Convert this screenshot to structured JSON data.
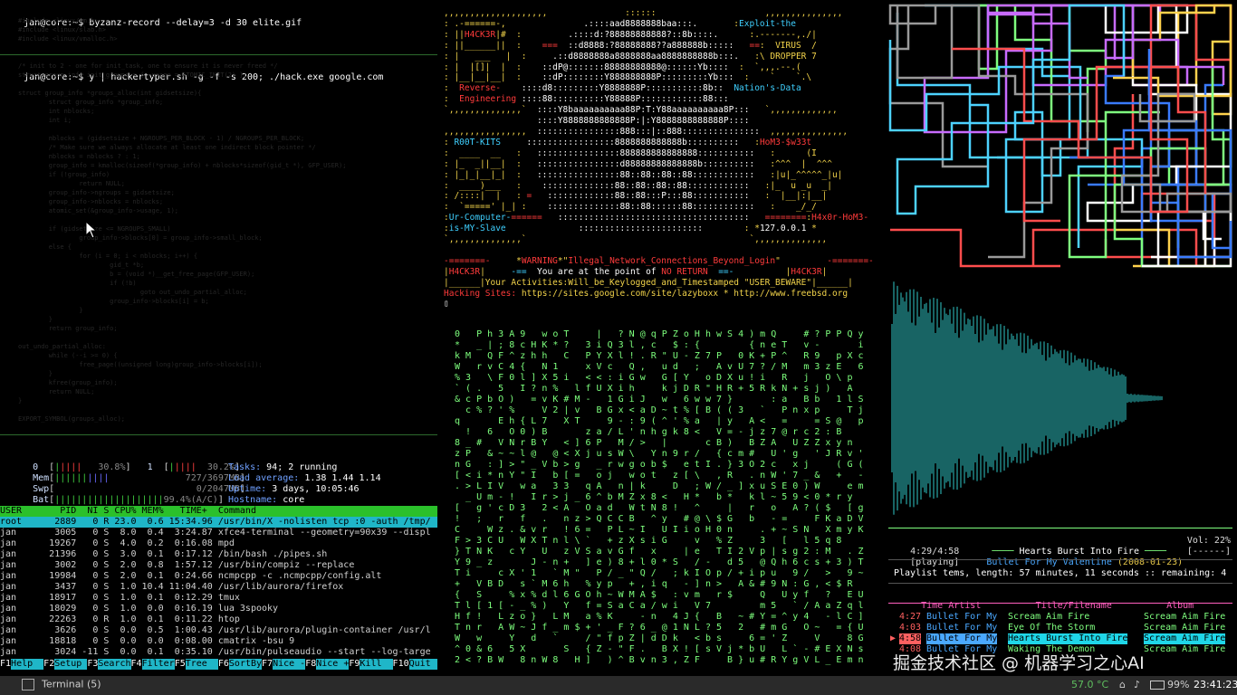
{
  "term1": {
    "cmd1_prompt": "jan@core:~$",
    "cmd1_text": " byzanz-record --delay=3 -d 30 elite.gif",
    "cmd2_prompt": "jan@core:~$",
    "cmd2_text": " y | hackertyper.sh -g -f -s 200; ./hack.exe google.com"
  },
  "htop": {
    "cpu0_label": "0",
    "cpu0_value": "30.8%",
    "cpu1_label": "1",
    "cpu1_value": "30.2%",
    "mem_label": "Mem",
    "mem_value": "727/3697MB",
    "swp_label": "Swp",
    "swp_value": "0/2047MB",
    "bat_label": "Bat",
    "bat_value": "99.4%(A/C)",
    "tasks_label": "Tasks:",
    "tasks_value": "94; 2 running",
    "load_label": "Load average:",
    "load_value": "1.38 1.44 1.14",
    "uptime_label": "Uptime:",
    "uptime_value": "3 days, 10:05:46",
    "hostname_label": "Hostname:",
    "hostname_value": "core",
    "columns": "USER       PID  NI S CPU% MEM%   TIME+  Command",
    "rows": [
      "root      2889   0 R 23.0  0.6 15:34.96 /usr/bin/X -nolisten tcp :0 -auth /tmp/",
      "jan       3005   0 S  8.0  0.4  3:24.87 xfce4-terminal --geometry=90x39 --displ",
      "jan      19267   0 S  4.0  0.2  0:16.08 mpd",
      "jan      21396   0 S  3.0  0.1  0:17.12 /bin/bash ./pipes.sh",
      "jan       3002   0 S  2.0  0.8  1:57.12 /usr/bin/compiz --replace",
      "jan      19984   0 S  2.0  0.1  0:24.66 ncmpcpp -c .ncmpcpp/config.alt",
      "jan       3437   0 S  1.0 10.4 11:04.40 /usr/lib/aurora/firefox",
      "jan      18917   0 S  1.0  0.1  0:12.29 tmux",
      "jan      18029   0 S  1.0  0.0  0:16.19 lua 3spooky",
      "jan      22263   0 R  1.0  0.1  0:11.22 htop",
      "jan       3626   0 S  0.0  0.5  1:00.43 /usr/lib/aurora/plugin-container /usr/l",
      "jan      18818   0 S  0.0  0.0  0:08.00 cmatrix -bsu 9",
      "jan       3024 -11 S  0.0  0.1  0:35.10 /usr/bin/pulseaudio --start --log-targe"
    ],
    "fkeys": [
      {
        "key": "F1",
        "label": "Help  "
      },
      {
        "key": "F2",
        "label": "Setup "
      },
      {
        "key": "F3",
        "label": "Search"
      },
      {
        "key": "F4",
        "label": "Filter"
      },
      {
        "key": "F5",
        "label": "Tree  "
      },
      {
        "key": "F6",
        "label": "SortBy"
      },
      {
        "key": "F7",
        "label": "Nice -"
      },
      {
        "key": "F8",
        "label": "Nice +"
      },
      {
        "key": "F9",
        "label": "Kill  "
      },
      {
        "key": "F10",
        "label": "Quit  "
      }
    ]
  },
  "banner": {
    "left_top": [
      "H4CK3R",
      "Reverse-",
      "Engineering"
    ],
    "right_top": [
      "Exploit-the",
      "VIRUS",
      "DROPPER 7",
      "Nation's-Data"
    ],
    "left_mid": [
      "R00T-KITS",
      "Ur-Computer-",
      "is-MY-Slave"
    ],
    "right_mid": [
      "HoM3-$w33t",
      "H4x0r-HoM3-",
      "127.0.0.1"
    ],
    "warning": "WARNING",
    "warning_msg": "Illegal_Network_Connections_Beyond_Login",
    "point_pre": "You are at the point of ",
    "no_return": "NO RETURN",
    "tag": "H4CK3R",
    "activities_label": "Your Activities:",
    "activities_text": "Will_be_Keylogged_and_Timestamped \"USER_BEWARE\"",
    "sites_label": "Hacking Sites:",
    "sites_text": "https://sites.google.com/site/lazyboxx * http://www.freebsd.org"
  },
  "ncmpcpp": {
    "time": "4:29/4:58",
    "now_title": "Hearts Burst Into Fire",
    "volume": "Vol: 22%",
    "state": "[playing]",
    "now_artist": "Bullet For My Valentine",
    "now_date": "(2008-01-23)",
    "flags": "[------]",
    "playlist_info": "Playlist tems, length: 57 minutes, 11 seconds :: remaining: 4",
    "col_time": "Time",
    "col_artist": "Artist",
    "col_title": "Title/Filename",
    "col_album": "Album",
    "rows": [
      {
        "time": "4:27",
        "artist": "Bullet For My",
        "title": "Scream Aim Fire",
        "album": "Scream Aim Fire"
      },
      {
        "time": "4:03",
        "artist": "Bullet For My",
        "title": "Eye Of The Storm",
        "album": "Scream Aim Fire"
      },
      {
        "time": "4:58",
        "artist": "Bullet For My",
        "title": "Hearts Burst Into Fire",
        "album": "Scream Aim Fire"
      },
      {
        "time": "4:08",
        "artist": "Bullet For My",
        "title": "Waking The Demon",
        "album": "Scream Aim Fire"
      }
    ]
  },
  "taskbar": {
    "window_label": "Terminal (5)",
    "temp": "57.0 °C",
    "battery": "99%",
    "clock": "23:41:23",
    "watermark": "掘金技术社区 @ 机器学习之心AI"
  }
}
